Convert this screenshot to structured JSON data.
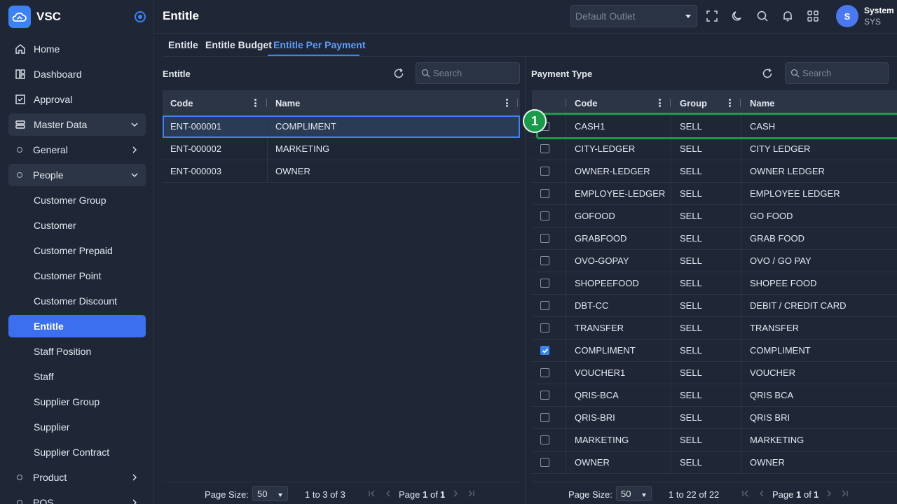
{
  "app": {
    "name": "VSC"
  },
  "sidebar": {
    "items": [
      {
        "label": "Home",
        "icon": "home-icon"
      },
      {
        "label": "Dashboard",
        "icon": "dashboard-icon"
      },
      {
        "label": "Approval",
        "icon": "approval-icon"
      },
      {
        "label": "Master Data",
        "icon": "database-icon",
        "expanded": true
      },
      {
        "label": "General",
        "expanded": false
      },
      {
        "label": "People",
        "expanded": true
      },
      {
        "label": "Customer Group"
      },
      {
        "label": "Customer"
      },
      {
        "label": "Customer Prepaid"
      },
      {
        "label": "Customer Point"
      },
      {
        "label": "Customer Discount"
      },
      {
        "label": "Entitle",
        "active": true
      },
      {
        "label": "Staff Position"
      },
      {
        "label": "Staff"
      },
      {
        "label": "Supplier Group"
      },
      {
        "label": "Supplier"
      },
      {
        "label": "Supplier Contract"
      },
      {
        "label": "Product",
        "expanded": false
      },
      {
        "label": "POS",
        "expanded": false
      }
    ]
  },
  "header": {
    "title": "Entitle",
    "outlet_placeholder": "Default Outlet",
    "user": {
      "initial": "S",
      "name": "System",
      "code": "SYS"
    }
  },
  "tabs": [
    {
      "label": "Entitle"
    },
    {
      "label": "Entitle Budget"
    },
    {
      "label": "Entitle Per Payment",
      "active": true
    }
  ],
  "entitle_panel": {
    "title": "Entitle",
    "search_placeholder": "Search",
    "columns": [
      "Code",
      "Name"
    ],
    "rows": [
      {
        "code": "ENT-000001",
        "name": "COMPLIMENT",
        "selected": true
      },
      {
        "code": "ENT-000002",
        "name": "MARKETING"
      },
      {
        "code": "ENT-000003",
        "name": "OWNER"
      }
    ],
    "pager": {
      "page_size_label": "Page Size:",
      "page_size": "50",
      "range": "1 to 3 of 3",
      "page_word": "Page",
      "page": "1",
      "of_word": "of",
      "total_pages": "1"
    }
  },
  "payment_panel": {
    "title": "Payment Type",
    "search_placeholder": "Search",
    "columns": [
      "Code",
      "Group",
      "Name"
    ],
    "rows": [
      {
        "code": "CASH1",
        "group": "SELL",
        "name": "CASH",
        "checked": false
      },
      {
        "code": "CITY-LEDGER",
        "group": "SELL",
        "name": "CITY LEDGER",
        "checked": false
      },
      {
        "code": "OWNER-LEDGER",
        "group": "SELL",
        "name": "OWNER LEDGER",
        "checked": false
      },
      {
        "code": "EMPLOYEE-LEDGER",
        "group": "SELL",
        "name": "EMPLOYEE LEDGER",
        "checked": false
      },
      {
        "code": "GOFOOD",
        "group": "SELL",
        "name": "GO FOOD",
        "checked": false
      },
      {
        "code": "GRABFOOD",
        "group": "SELL",
        "name": "GRAB FOOD",
        "checked": false
      },
      {
        "code": "OVO-GOPAY",
        "group": "SELL",
        "name": "OVO / GO PAY",
        "checked": false
      },
      {
        "code": "SHOPEEFOOD",
        "group": "SELL",
        "name": "SHOPEE FOOD",
        "checked": false
      },
      {
        "code": "DBT-CC",
        "group": "SELL",
        "name": "DEBIT / CREDIT CARD",
        "checked": false
      },
      {
        "code": "TRANSFER",
        "group": "SELL",
        "name": "TRANSFER",
        "checked": false
      },
      {
        "code": "COMPLIMENT",
        "group": "SELL",
        "name": "COMPLIMENT",
        "checked": true
      },
      {
        "code": "VOUCHER1",
        "group": "SELL",
        "name": "VOUCHER",
        "checked": false
      },
      {
        "code": "QRIS-BCA",
        "group": "SELL",
        "name": "QRIS BCA",
        "checked": false
      },
      {
        "code": "QRIS-BRI",
        "group": "SELL",
        "name": "QRIS BRI",
        "checked": false
      },
      {
        "code": "MARKETING",
        "group": "SELL",
        "name": "MARKETING",
        "checked": false
      },
      {
        "code": "OWNER",
        "group": "SELL",
        "name": "OWNER",
        "checked": false
      }
    ],
    "pager": {
      "page_size_label": "Page Size:",
      "page_size": "50",
      "range": "1 to 22 of 22",
      "page_word": "Page",
      "page": "1",
      "of_word": "of",
      "total_pages": "1"
    }
  },
  "annotation": {
    "label": "1",
    "color": "#1a9b4b"
  },
  "colors": {
    "accent": "#3b82f6",
    "background": "#1f2737",
    "annotation": "#1a9b4b"
  }
}
